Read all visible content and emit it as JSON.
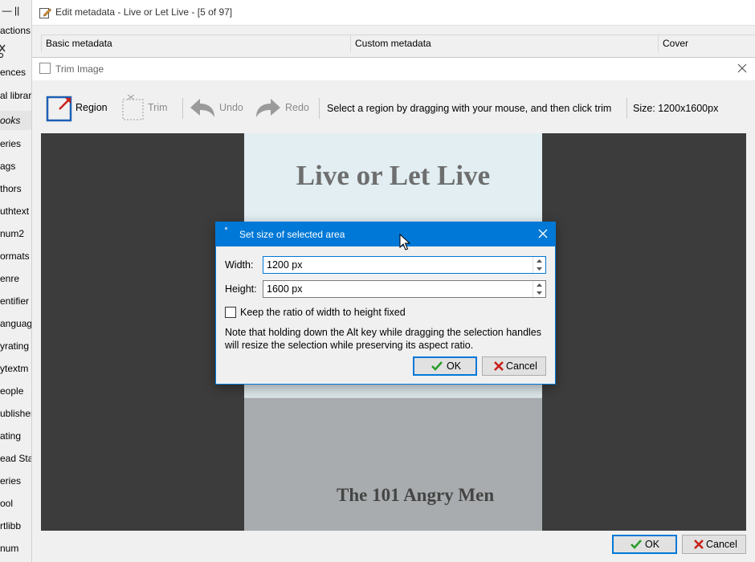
{
  "sidebar": {
    "items": [
      {
        "label": "ore — ||"
      },
      {
        "label": "actions"
      },
      {
        "label": "ences"
      },
      {
        "label": "al librar"
      },
      {
        "label": "ooks"
      },
      {
        "label": "eries"
      },
      {
        "label": "ags"
      },
      {
        "label": "thors"
      },
      {
        "label": "uthtext"
      },
      {
        "label": "num2"
      },
      {
        "label": "ormats"
      },
      {
        "label": "enre"
      },
      {
        "label": "entifier"
      },
      {
        "label": "anguag"
      },
      {
        "label": "yrating"
      },
      {
        "label": "ytextm"
      },
      {
        "label": "eople"
      },
      {
        "label": "ublisher"
      },
      {
        "label": "ating"
      },
      {
        "label": "ead Sta"
      },
      {
        "label": "eries"
      },
      {
        "label": "ool"
      },
      {
        "label": "rtlibb"
      },
      {
        "label": "num"
      }
    ]
  },
  "meta_window": {
    "title": "Edit metadata - Live or Let Live - [5 of 97]",
    "sections": {
      "basic": "Basic metadata",
      "custom": "Custom metadata",
      "cover": "Cover"
    }
  },
  "trim_window": {
    "title": "Trim Image",
    "toolbar": {
      "region": "Region",
      "trim": "Trim",
      "undo": "Undo",
      "redo": "Redo",
      "hint": "Select a region by dragging with your mouse, and then click trim",
      "size": "Size: 1200x1600px"
    },
    "cover": {
      "title": "Live or Let Live",
      "subtitle": "The 101 Angry Men"
    },
    "buttons": {
      "ok": "OK",
      "cancel": "Cancel"
    }
  },
  "size_dialog": {
    "title": "Set size of selected area",
    "width_label": "Width:",
    "width_value": "1200 px",
    "height_label": "Height:",
    "height_value": "1600 px",
    "ratio_label": "Keep the ratio of width to height fixed",
    "ratio_checked": false,
    "note": "Note that holding down the Alt key while dragging the selection handles will resize the selection while preserving its aspect ratio.",
    "ok": "OK",
    "cancel": "Cancel"
  },
  "colors": {
    "accent": "#0078d7",
    "canvas": "#3c3c3c",
    "ok_check": "#2a9d2a",
    "cancel_x": "#c8201a",
    "region_icon": "#1e5fb4"
  }
}
